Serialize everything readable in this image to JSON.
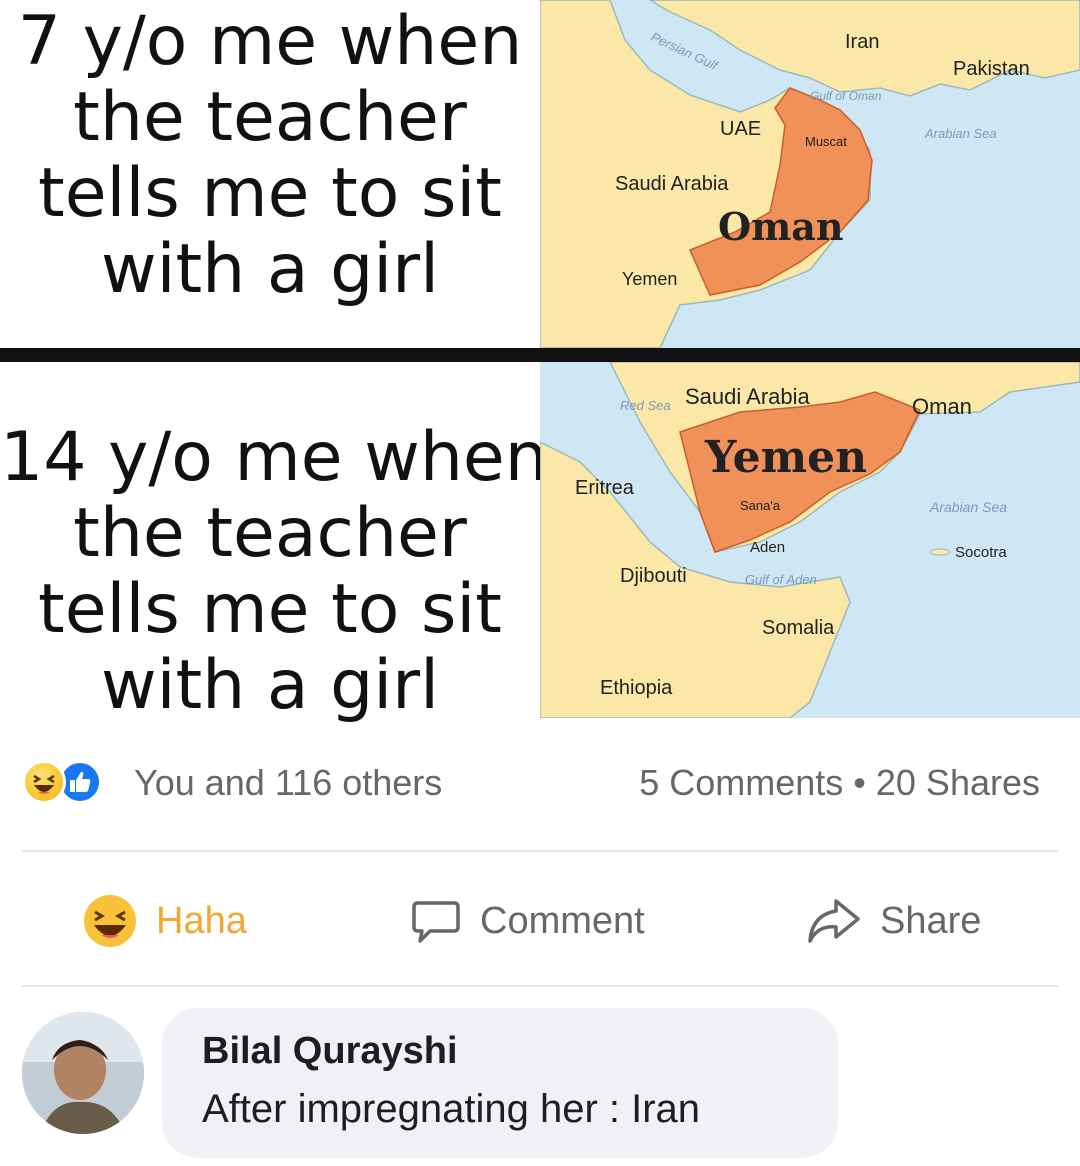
{
  "meme": {
    "top_caption": [
      "7 y/o me when",
      "the teacher",
      "tells me to sit",
      "with a girl"
    ],
    "bottom_caption": [
      "14 y/o me when",
      "the teacher",
      "tells me to sit",
      "with a girl"
    ],
    "top_map": {
      "labels": {
        "iran": "Iran",
        "pakistan": "Pakistan",
        "persian_gulf": "Persian Gulf",
        "gulf_of_oman": "Gulf of Oman",
        "arabian_sea": "Arabian Sea",
        "uae": "UAE",
        "muscat": "Muscat",
        "saudi_arabia": "Saudi Arabia",
        "oman": "Oman",
        "yemen": "Yemen"
      },
      "colors": {
        "highlight": "#f0915a",
        "land": "#fbe7a8",
        "sea": "#cfe6f5"
      }
    },
    "bottom_map": {
      "labels": {
        "red_sea": "Red Sea",
        "saudi_arabia": "Saudi Arabia",
        "oman": "Oman",
        "yemen": "Yemen",
        "eritrea": "Eritrea",
        "sanaa": "Sana'a",
        "arabian_sea": "Arabian Sea",
        "aden": "Aden",
        "socotra": "Socotra",
        "djibouti": "Djibouti",
        "gulf_of_aden": "Gulf of Aden",
        "somalia": "Somalia",
        "ethiopia": "Ethiopia"
      },
      "colors": {
        "highlight": "#f0915a",
        "land": "#fbe7a8",
        "sea": "#cfe6f5"
      }
    }
  },
  "post": {
    "reactions_text": "You and 116 others",
    "reaction_icons": [
      "haha-icon",
      "like-icon"
    ],
    "comments_shares_text": "5 Comments • 20 Shares",
    "actions": {
      "haha_label": "Haha",
      "comment_label": "Comment",
      "share_label": "Share"
    },
    "accent_colors": {
      "haha": "#f0a830",
      "like": "#1877f2",
      "muted": "#65676b"
    }
  },
  "comment": {
    "author": "Bilal Qurayshi",
    "text": "After impregnating her : Iran"
  }
}
